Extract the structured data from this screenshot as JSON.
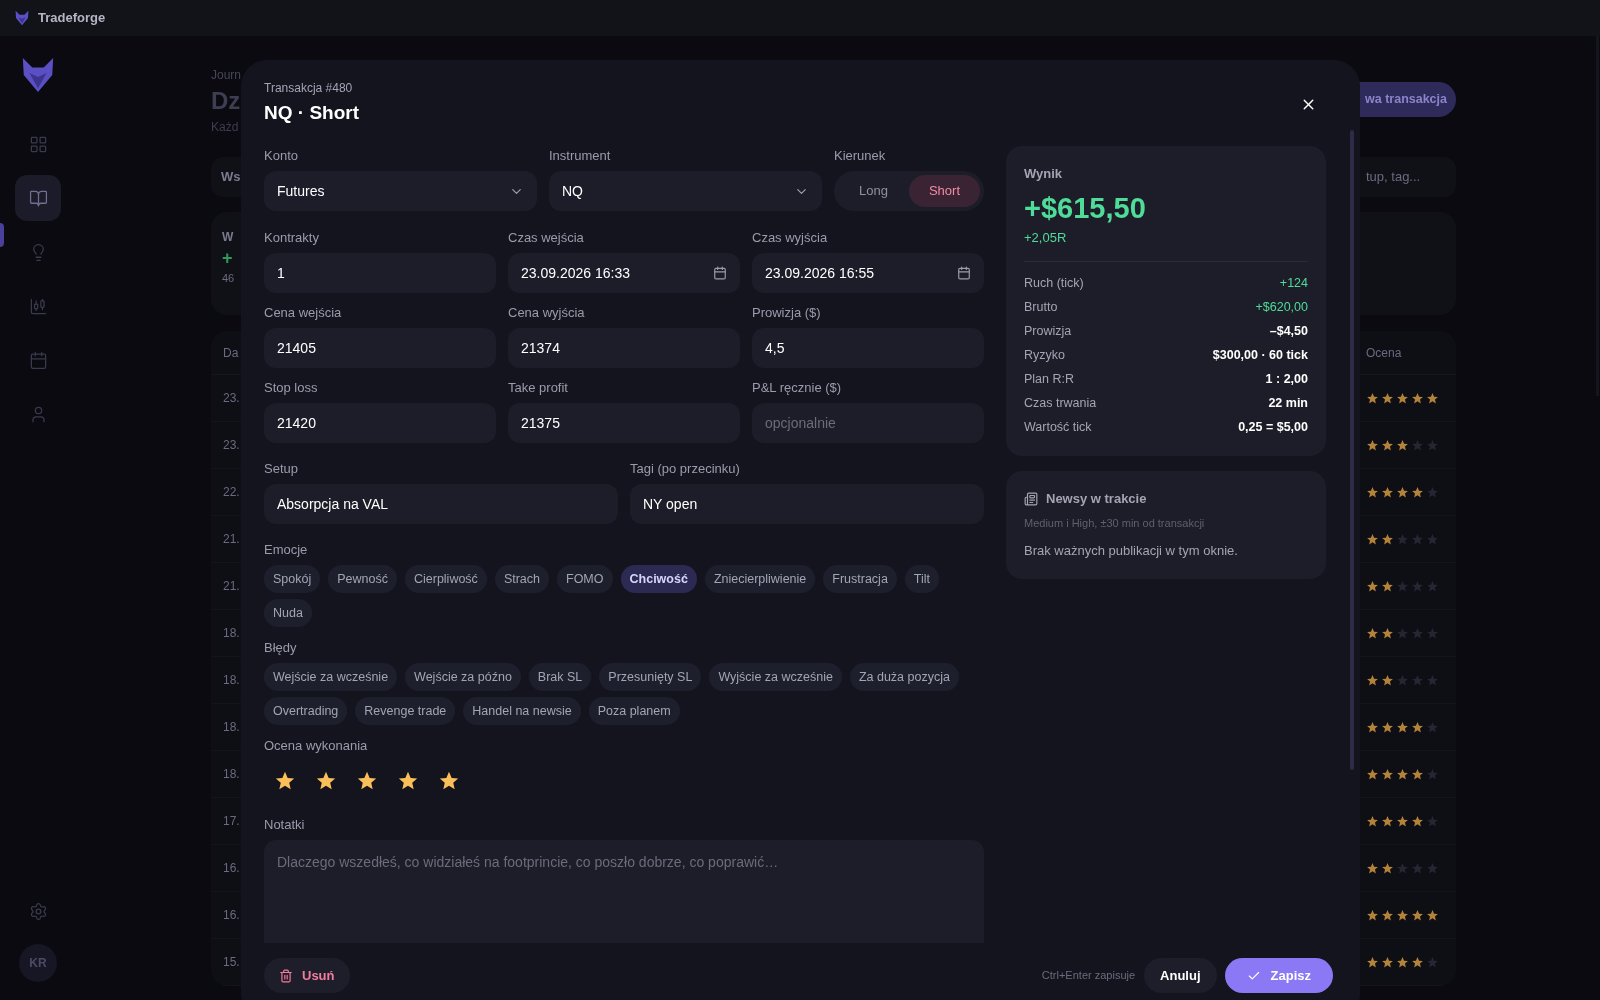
{
  "app": {
    "name": "Tradeforge"
  },
  "sidebar": {
    "items": [
      {
        "kind": "grid",
        "selected": false
      },
      {
        "kind": "journal",
        "selected": true
      },
      {
        "kind": "idea",
        "selected": false
      },
      {
        "kind": "candles",
        "selected": false
      },
      {
        "kind": "calendar",
        "selected": false
      },
      {
        "kind": "user",
        "selected": false
      }
    ],
    "avatar": "KR"
  },
  "page": {
    "breadcrumb": "Journ",
    "title": "Dz",
    "subtitle": "Każd",
    "new_button": "wa transakcja",
    "filter": "Ws",
    "search_placeholder": "tup, tag...",
    "stat": {
      "label": "W",
      "value": "+",
      "sub": "46"
    },
    "table": {
      "columns": [
        "Da",
        "Ocena"
      ],
      "rows": [
        {
          "date": "23.",
          "stars": 5
        },
        {
          "date": "23.",
          "stars": 3
        },
        {
          "date": "22.",
          "stars": 4
        },
        {
          "date": "21.",
          "stars": 2
        },
        {
          "date": "21.",
          "stars": 2
        },
        {
          "date": "18.",
          "stars": 2
        },
        {
          "date": "18.",
          "stars": 2
        },
        {
          "date": "18.",
          "stars": 4
        },
        {
          "date": "18.",
          "stars": 4
        },
        {
          "date": "17.",
          "stars": 4
        },
        {
          "date": "16.",
          "stars": 2
        },
        {
          "date": "16.",
          "stars": 5
        },
        {
          "date": "15.",
          "stars": 4
        }
      ]
    }
  },
  "modal": {
    "subtitle": "Transakcja #480",
    "title": "NQ · Short",
    "account": {
      "label": "Konto",
      "value": "Futures"
    },
    "instrument": {
      "label": "Instrument",
      "value": "NQ"
    },
    "direction": {
      "label": "Kierunek",
      "options": [
        {
          "label": "Long",
          "selected": false
        },
        {
          "label": "Short",
          "selected": true
        }
      ]
    },
    "fields": [
      {
        "kind": "text",
        "label": "Kontrakty",
        "value": "1"
      },
      {
        "kind": "datetime",
        "label": "Czas wejścia",
        "value": "23.09.2026 16:33"
      },
      {
        "kind": "datetime",
        "label": "Czas wyjścia",
        "value": "23.09.2026 16:55"
      },
      {
        "kind": "text",
        "label": "Cena wejścia",
        "value": "21405"
      },
      {
        "kind": "text",
        "label": "Cena wyjścia",
        "value": "21374"
      },
      {
        "kind": "text",
        "label": "Prowizja ($)",
        "value": "4,5"
      },
      {
        "kind": "text",
        "label": "Stop loss",
        "value": "21420"
      },
      {
        "kind": "text",
        "label": "Take profit",
        "value": "21375"
      },
      {
        "kind": "text",
        "label": "P&L ręcznie ($)",
        "placeholder": "opcjonalnie"
      }
    ],
    "setup": {
      "label": "Setup",
      "value": "Absorpcja na VAL"
    },
    "tags": {
      "label": "Tagi (po przecinku)",
      "value": "NY open"
    },
    "emotions": {
      "label": "Emocje",
      "chips": [
        {
          "label": "Spokój",
          "selected": false
        },
        {
          "label": "Pewność",
          "selected": false
        },
        {
          "label": "Cierpliwość",
          "selected": false
        },
        {
          "label": "Strach",
          "selected": false
        },
        {
          "label": "FOMO",
          "selected": false
        },
        {
          "label": "Chciwość",
          "selected": true
        },
        {
          "label": "Zniecierpliwienie",
          "selected": false
        },
        {
          "label": "Frustracja",
          "selected": false
        },
        {
          "label": "Tilt",
          "selected": false
        },
        {
          "label": "Nuda",
          "selected": false
        }
      ]
    },
    "mistakes": {
      "label": "Błędy",
      "chips": [
        {
          "label": "Wejście za wcześnie",
          "selected": false
        },
        {
          "label": "Wejście za późno",
          "selected": false
        },
        {
          "label": "Brak SL",
          "selected": false
        },
        {
          "label": "Przesunięty SL",
          "selected": false
        },
        {
          "label": "Wyjście za wcześnie",
          "selected": false
        },
        {
          "label": "Za duża pozycja",
          "selected": false
        },
        {
          "label": "Overtrading",
          "selected": false
        },
        {
          "label": "Revenge trade",
          "selected": false
        },
        {
          "label": "Handel na newsie",
          "selected": false
        },
        {
          "label": "Poza planem",
          "selected": false
        }
      ]
    },
    "rating": {
      "label": "Ocena wykonania",
      "stars": 5
    },
    "notes": {
      "label": "Notatki",
      "placeholder": "Dlaczego wszedłeś, co widziałeś na footprincie, co poszło dobrze, co poprawić…"
    },
    "result": {
      "label": "Wynik",
      "pnl": "+$615,50",
      "r": "+2,05R",
      "rows": [
        {
          "label": "Ruch (tick)",
          "value": "+124",
          "kind": "positive"
        },
        {
          "label": "Brutto",
          "value": "+$620,00",
          "kind": "positive"
        },
        {
          "label": "Prowizja",
          "value": "–$4,50",
          "kind": "neutral"
        },
        {
          "label": "Ryzyko",
          "value": "$300,00 · 60 tick",
          "kind": "neutral"
        },
        {
          "label": "Plan R:R",
          "value": "1 : 2,00",
          "kind": "neutral"
        },
        {
          "label": "Czas trwania",
          "value": "22 min",
          "kind": "neutral"
        },
        {
          "label": "Wartość tick",
          "value": "0,25 = $5,00",
          "kind": "neutral"
        }
      ]
    },
    "news": {
      "title": "Newsy w trakcie",
      "subtitle": "Medium i High, ±30 min od transakcji",
      "text": "Brak ważnych publikacji w tym oknie."
    },
    "footer": {
      "delete": "Usuń",
      "hint": "Ctrl+Enter zapisuje",
      "cancel": "Anuluj",
      "save": "Zapisz"
    }
  }
}
